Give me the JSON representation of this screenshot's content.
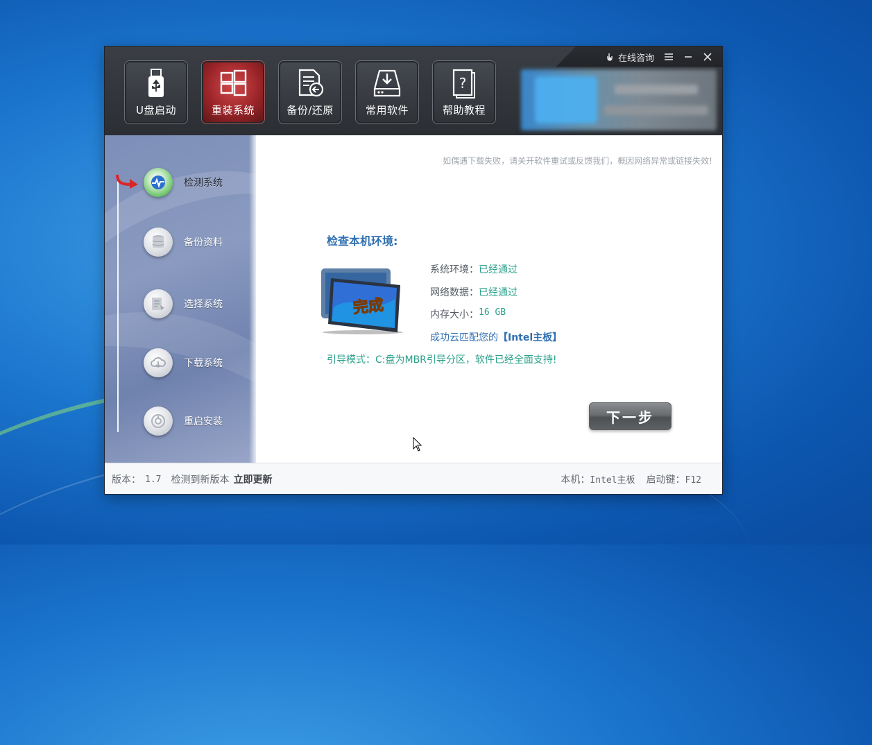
{
  "window": {
    "title_controls": {
      "consult_label": "在线咨询",
      "menu_icon": "menu-icon",
      "minimize_icon": "minimize-icon",
      "close_icon": "close-icon"
    },
    "toolbar": [
      {
        "label": "U盘启动",
        "icon": "usb-icon",
        "active": false
      },
      {
        "label": "重装系统",
        "icon": "windows-icon",
        "active": true
      },
      {
        "label": "备份/还原",
        "icon": "backup-restore-icon",
        "active": false
      },
      {
        "label": "常用软件",
        "icon": "software-tray-icon",
        "active": false
      },
      {
        "label": "帮助教程",
        "icon": "help-book-icon",
        "active": false
      }
    ]
  },
  "sidebar": {
    "steps": [
      {
        "label": "检测系统",
        "icon": "pulse-icon",
        "active": true
      },
      {
        "label": "备份资料",
        "icon": "database-icon",
        "active": false
      },
      {
        "label": "选择系统",
        "icon": "system-select-icon",
        "active": false
      },
      {
        "label": "下载系统",
        "icon": "cloud-download-icon",
        "active": false
      },
      {
        "label": "重启安装",
        "icon": "restart-icon",
        "active": false
      }
    ]
  },
  "main": {
    "notice": "如偶遇下载失败，请关开软件重试或反馈我们，概因网络异常或链接失效!",
    "check_title": "检查本机环境:",
    "tablet_badge": "完成",
    "checks": [
      {
        "label": "系统环境：",
        "value": "已经通过"
      },
      {
        "label": "网络数据：",
        "value": "已经通过"
      },
      {
        "label": "内存大小：",
        "value": "16 GB"
      }
    ],
    "matched_prefix": "成功云匹配您的",
    "matched_board": "【Intel主板】",
    "boot_mode": "引导模式：C:盘为MBR引导分区，软件已经全面支持!",
    "next_button": "下一步"
  },
  "footer": {
    "version_label": "版本：",
    "version_value": "1.7",
    "new_version_text": "检测到新版本",
    "update_link": "立即更新",
    "board_label": "本机：",
    "board_value": "Intel主板",
    "boot_key_label": "启动键：",
    "boot_key_value": "F12"
  },
  "colors": {
    "accent_blue": "#2f6fb0",
    "pass_green": "#2aa08a",
    "active_tool_red": "#9a2428",
    "header_dark": "#2b2e33"
  }
}
